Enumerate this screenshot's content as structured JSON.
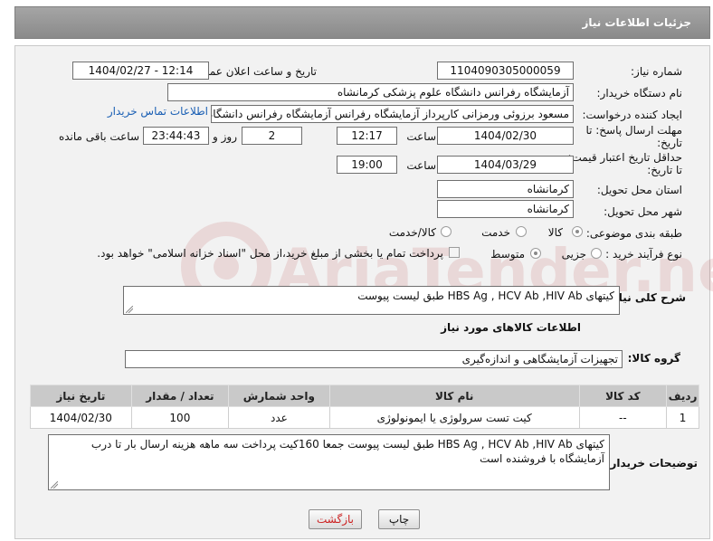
{
  "header": {
    "title": "جزئیات اطلاعات نیاز"
  },
  "fields": {
    "need_number_label": "شماره نیاز:",
    "need_number": "1104090305000059",
    "announce_label": "تاریخ و ساعت اعلان عمومی:",
    "announce_value": "1404/02/27 - 12:14",
    "buyer_org_label": "نام دستگاه خریدار:",
    "buyer_org": "آزمایشگاه رفرانس دانشگاه علوم پزشکی کرمانشاه",
    "creator_label": "ایجاد کننده درخواست:",
    "creator": "مسعود برزوئی ورمزانی کارپرداز آزمایشگاه رفرانس آزمایشگاه رفرانس دانشگاه ع",
    "contact_link": "اطلاعات تماس خریدار",
    "deadline_label_1": "مهلت ارسال پاسخ: تا",
    "deadline_label_2": "تاریخ:",
    "deadline_date": "1404/02/30",
    "time_label": "ساعت",
    "deadline_time": "12:17",
    "days_value": "2",
    "days_label": "روز و",
    "remaining_time": "23:44:43",
    "remaining_label": "ساعت باقی مانده",
    "validity_label_1": "حداقل تاریخ اعتبار قیمت:",
    "validity_label_2": "تا تاریخ:",
    "validity_date": "1404/03/29",
    "validity_time": "19:00",
    "province_label": "استان محل تحویل:",
    "province": "کرمانشاه",
    "city_label": "شهر محل تحویل:",
    "city": "کرمانشاه",
    "category_label": "طبقه بندی موضوعی:",
    "category_options": [
      "کالا",
      "خدمت",
      "کالا/خدمت"
    ],
    "process_label": "نوع فرآیند خرید :",
    "process_options": [
      "جزیی",
      "متوسط"
    ],
    "payment_note": "پرداخت تمام یا بخشی از مبلغ خرید،از محل \"اسناد خزانه اسلامی\" خواهد بود."
  },
  "description": {
    "label": "شرح کلی نیاز:",
    "value": "کیتهای HBS Ag , HCV Ab ,HIV Ab طبق لیست پیوست"
  },
  "goods_section": {
    "title": "اطلاعات کالاهای مورد نیاز",
    "group_label": "گروه کالا:",
    "group_value": "تجهیزات آزمایشگاهی و اندازه‌گیری"
  },
  "table": {
    "headers": [
      "ردیف",
      "کد کالا",
      "نام کالا",
      "واحد شمارش",
      "تعداد / مقدار",
      "تاریخ نیاز"
    ],
    "rows": [
      [
        "1",
        "--",
        "کیت تست سرولوژی یا ایمونولوژی",
        "عدد",
        "100",
        "1404/02/30"
      ]
    ]
  },
  "buyer_notes": {
    "label": "توضیحات خریدار:",
    "value": "کیتهای HBS Ag , HCV Ab ,HIV Ab طبق لیست پیوست جمعا 160کیت پرداخت سه ماهه هزینه ارسال بار تا درب آزمایشگاه با فروشنده است"
  },
  "buttons": {
    "print": "چاپ",
    "back": "بازگشت"
  },
  "watermark": "AriaTender.neT",
  "colors": {
    "header_bg": "#959595",
    "link": "#1a5fb4",
    "table_header": "#c9c9c9",
    "back_button_text": "#cc2222"
  }
}
